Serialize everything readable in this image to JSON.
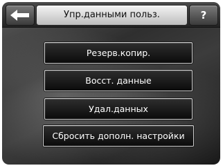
{
  "header": {
    "title": "Упр.данными польз.",
    "help_label": "?",
    "back_icon": "arrow-left-icon"
  },
  "menu": {
    "items": [
      {
        "label": "Резерв.копир."
      },
      {
        "label": "Восст. данные"
      },
      {
        "label": "Удал.данных"
      },
      {
        "label": "Сбросить дополн. настройки"
      }
    ]
  },
  "colors": {
    "title_bg": "#e0e0e0",
    "button_bg": "#141414",
    "button_border": "#d0d0d0",
    "text_light": "#ffffff"
  }
}
